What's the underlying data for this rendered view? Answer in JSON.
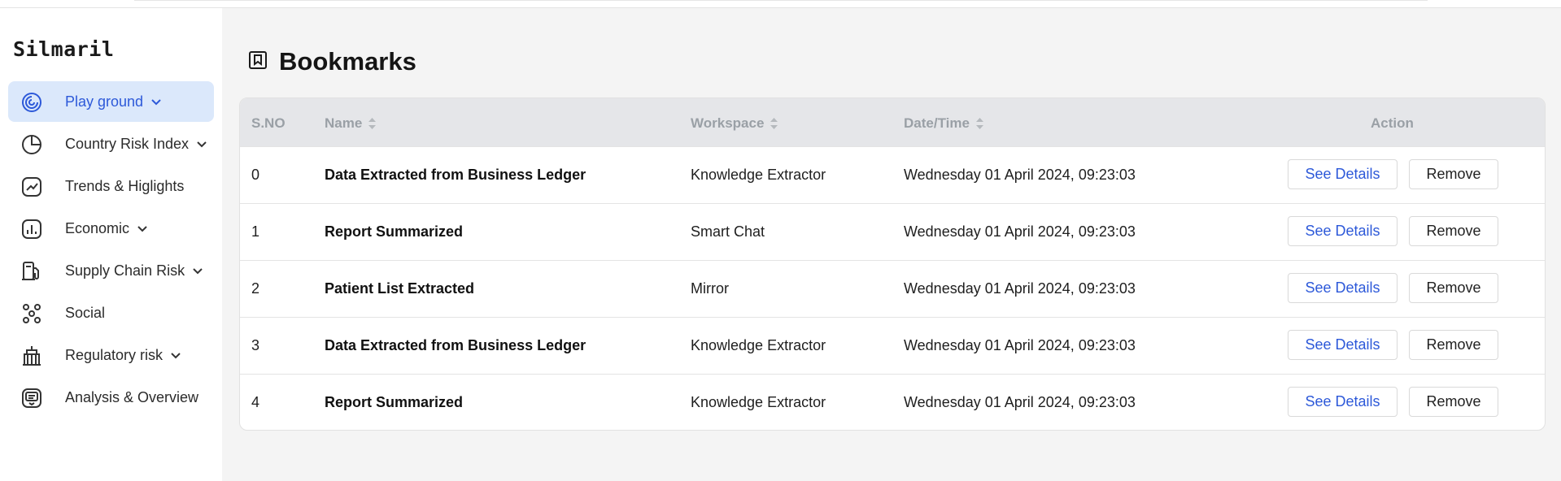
{
  "app": {
    "brand": "Silmaril"
  },
  "sidebar": {
    "items": [
      {
        "label": "Play ground",
        "icon": "spiral-icon",
        "dropdown": true,
        "active": true
      },
      {
        "label": "Country Risk Index",
        "icon": "pie-chart-icon",
        "dropdown": true,
        "active": false
      },
      {
        "label": "Trends & Higlights",
        "icon": "trend-chart-icon",
        "dropdown": false,
        "active": false
      },
      {
        "label": "Economic",
        "icon": "bar-chart-icon",
        "dropdown": true,
        "active": false
      },
      {
        "label": "Supply Chain Risk",
        "icon": "fuel-pump-icon",
        "dropdown": true,
        "active": false
      },
      {
        "label": "Social",
        "icon": "people-network-icon",
        "dropdown": false,
        "active": false
      },
      {
        "label": "Regulatory risk",
        "icon": "building-icon",
        "dropdown": true,
        "active": false
      },
      {
        "label": "Analysis & Overview",
        "icon": "message-list-icon",
        "dropdown": false,
        "active": false
      }
    ]
  },
  "page": {
    "title": "Bookmarks",
    "icon": "bookmark-icon"
  },
  "table": {
    "headers": {
      "sno": "S.NO",
      "name": "Name",
      "workspace": "Workspace",
      "datetime": "Date/Time",
      "action": "Action"
    },
    "rows": [
      {
        "sno": "0",
        "name": "Data Extracted from Business Ledger",
        "workspace": "Knowledge Extractor",
        "datetime": "Wednesday 01 April 2024, 09:23:03",
        "details": "See Details",
        "remove": "Remove"
      },
      {
        "sno": "1",
        "name": "Report Summarized",
        "workspace": "Smart Chat",
        "datetime": "Wednesday 01 April 2024, 09:23:03",
        "details": "See Details",
        "remove": "Remove"
      },
      {
        "sno": "2",
        "name": "Patient List Extracted",
        "workspace": "Mirror",
        "datetime": "Wednesday 01 April 2024, 09:23:03",
        "details": "See Details",
        "remove": "Remove"
      },
      {
        "sno": "3",
        "name": "Data Extracted from Business Ledger",
        "workspace": "Knowledge Extractor",
        "datetime": "Wednesday 01 April 2024, 09:23:03",
        "details": "See Details",
        "remove": "Remove"
      },
      {
        "sno": "4",
        "name": "Report Summarized",
        "workspace": "Knowledge Extractor",
        "datetime": "Wednesday 01 April 2024, 09:23:03",
        "details": "See Details",
        "remove": "Remove"
      }
    ]
  },
  "colors": {
    "accent": "#2d59d9",
    "active_bg": "#dbe8fb",
    "header_bg": "#e5e6e9",
    "header_text": "#9aa0a6",
    "page_bg": "#f4f4f4"
  }
}
